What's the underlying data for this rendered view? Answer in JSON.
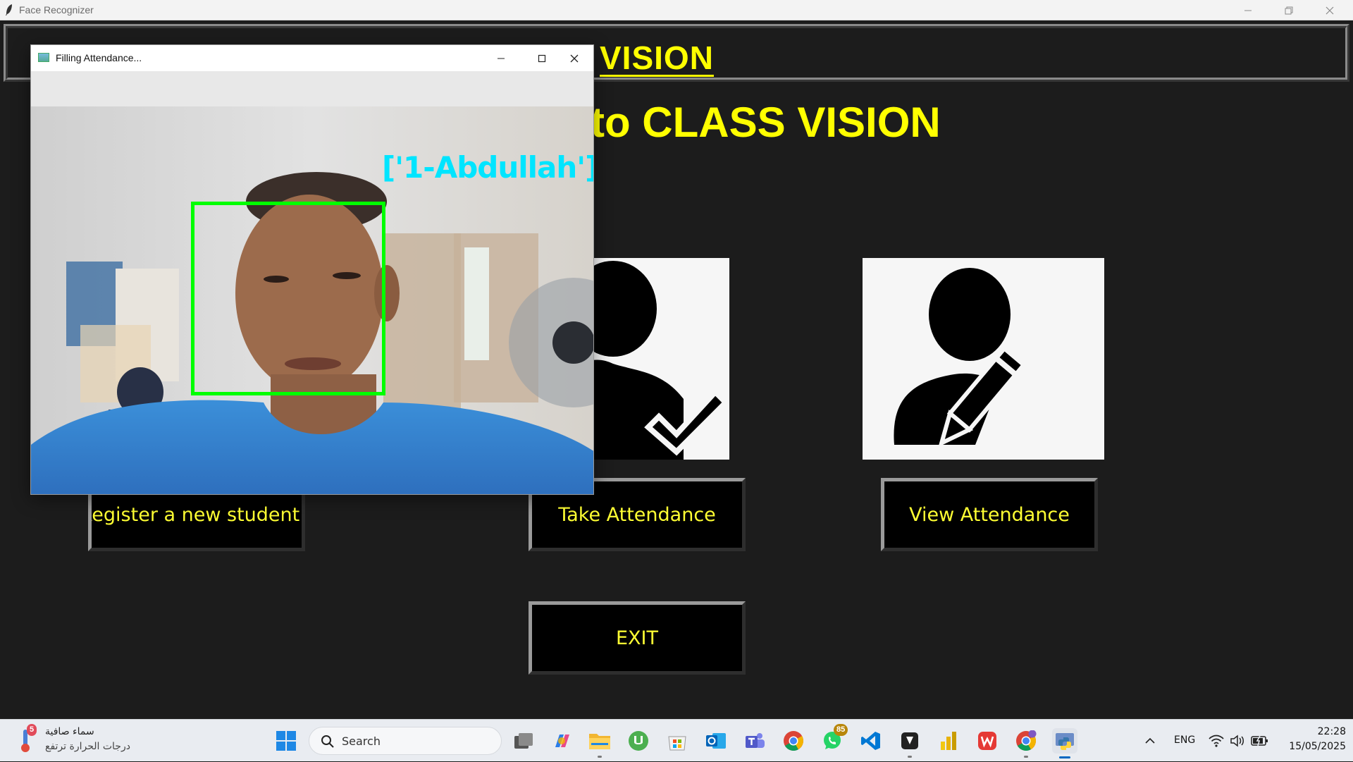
{
  "main_window": {
    "title": "Face Recognizer",
    "header_text": "VISION",
    "welcome_text": "to CLASS VISION",
    "buttons": {
      "register": "Register a new student",
      "take_attendance": "Take Attendance",
      "view_attendance": "View Attendance",
      "exit": "EXIT"
    },
    "text_color": "#ffff00",
    "background_color": "#1c1c1c"
  },
  "popup": {
    "title": "Filling Attendance...",
    "recognized_label": "['1-Abdullah']",
    "box_color": "#00ff00",
    "label_color": "#00e5ff"
  },
  "taskbar": {
    "weather": {
      "badge": "5",
      "line1": "سماء صافية",
      "line2": "درجات الحرارة ترتفع"
    },
    "search_placeholder": "Search",
    "apps": [
      {
        "name": "start-icon"
      },
      {
        "name": "task-view-icon"
      },
      {
        "name": "copilot-icon"
      },
      {
        "name": "file-explorer-icon"
      },
      {
        "name": "utorrent-icon"
      },
      {
        "name": "microsoft-store-icon"
      },
      {
        "name": "outlook-icon"
      },
      {
        "name": "teams-icon"
      },
      {
        "name": "chrome-icon"
      },
      {
        "name": "whatsapp-icon",
        "badge": "85"
      },
      {
        "name": "vscode-icon"
      },
      {
        "name": "obs-icon"
      },
      {
        "name": "powerbi-icon"
      },
      {
        "name": "wps-office-icon"
      },
      {
        "name": "chrome-profile-icon"
      },
      {
        "name": "python-icon"
      }
    ],
    "tray": {
      "language": "ENG",
      "time": "22:28",
      "date": "15/05/2025"
    }
  }
}
